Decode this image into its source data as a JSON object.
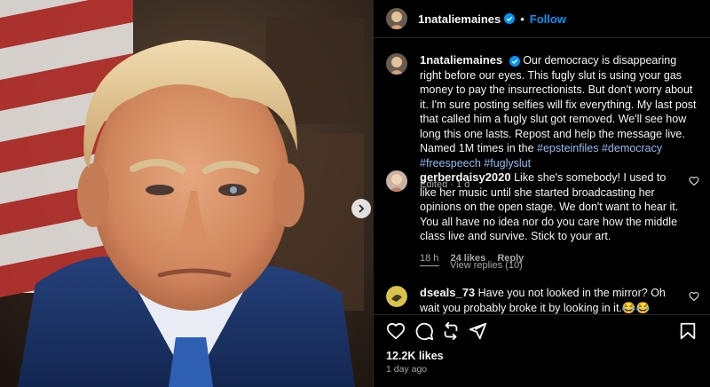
{
  "post": {
    "author": "1nataliemaines",
    "follow_label": "Follow",
    "separator": "•",
    "caption": {
      "author": "1nataliemaines",
      "text": "Our democracy is disappearing right before our eyes. This fugly slut is using your gas money to pay the insurrectionists. But don't worry about it. I'm sure posting selfies will fix everything. My last post that called him a fugly slut got removed. We'll see how long this one lasts. Repost and help the message live. Named 1M times in the ",
      "hashtags": [
        "#epsteinfiles",
        "#democracy",
        "#freespeech",
        "#fuglyslut"
      ],
      "meta": "Edited · 1 d"
    },
    "likes": "12.2K likes",
    "time_ago": "1 day ago"
  },
  "comments": [
    {
      "user": "gerberdaisy2020",
      "text": "Like she's somebody! I used to like her music until she started broadcasting her opinions on the open stage. We don't want to hear it. You all have no idea nor do you care how the middle class live and survive. Stick to your art.",
      "time": "18 h",
      "likes": "24 likes",
      "reply": "Reply",
      "view_replies": "View replies (10)"
    },
    {
      "user": "dseals_73",
      "text": "Have you not looked in the mirror? Oh wait you probably broke it by looking in it.😂😂"
    }
  ],
  "icons": {
    "verified": "verified-badge-icon",
    "like": "heart-icon",
    "comment": "comment-bubble-icon",
    "share": "repost-icon",
    "send": "send-icon",
    "save": "bookmark-icon",
    "next": "chevron-right-icon"
  },
  "colors": {
    "accent": "#0095f6",
    "background": "#000000",
    "hashtag": "#8cbcf7"
  }
}
